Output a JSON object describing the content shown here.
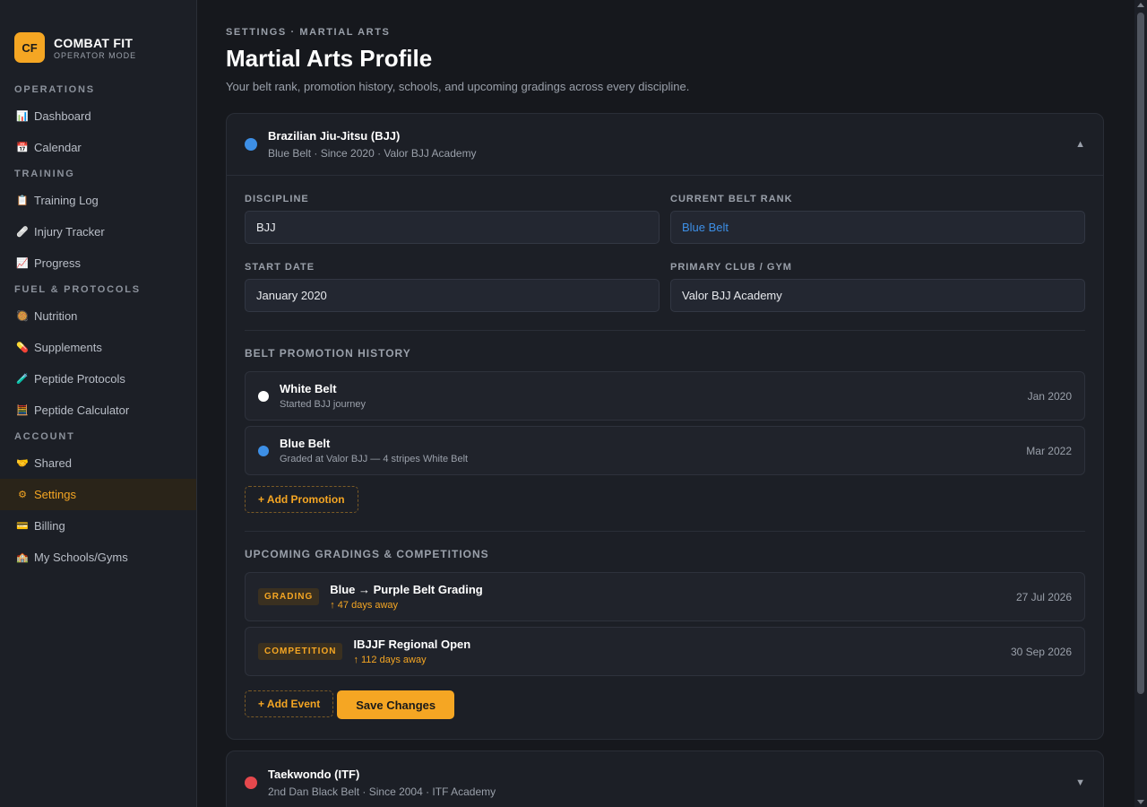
{
  "brand": {
    "logo": "CF",
    "name": "COMBAT FIT",
    "sub": "OPERATOR MODE"
  },
  "nav": {
    "sections": [
      {
        "label": "OPERATIONS",
        "items": [
          {
            "label": "Dashboard",
            "icon": "📊"
          },
          {
            "label": "Calendar",
            "icon": "📅"
          }
        ]
      },
      {
        "label": "TRAINING",
        "items": [
          {
            "label": "Training Log",
            "icon": "📋"
          },
          {
            "label": "Injury Tracker",
            "icon": "🩹"
          },
          {
            "label": "Progress",
            "icon": "📈"
          }
        ]
      },
      {
        "label": "FUEL & PROTOCOLS",
        "items": [
          {
            "label": "Nutrition",
            "icon": "🥘"
          },
          {
            "label": "Supplements",
            "icon": "💊"
          },
          {
            "label": "Peptide Protocols",
            "icon": "🧪"
          },
          {
            "label": "Peptide Calculator",
            "icon": "🧮"
          }
        ]
      },
      {
        "label": "ACCOUNT",
        "items": [
          {
            "label": "Shared",
            "icon": "🤝"
          },
          {
            "label": "Settings",
            "icon": "⚙"
          },
          {
            "label": "Billing",
            "icon": "💳"
          },
          {
            "label": "My Schools/Gyms",
            "icon": "🏫"
          }
        ]
      }
    ],
    "active": "Settings"
  },
  "header": {
    "breadcrumb": "SETTINGS · MARTIAL ARTS",
    "title": "Martial Arts Profile",
    "subtitle": "Your belt rank, promotion history, schools, and upcoming gradings across every discipline."
  },
  "bjj": {
    "title": "Brazilian Jiu-Jitsu (BJJ)",
    "sub": "Blue Belt · Since 2020 · Valor BJJ Academy",
    "color": "#3d8fe6",
    "caret": "▲",
    "fields": {
      "discipline_label": "DISCIPLINE",
      "discipline_value": "BJJ",
      "rank_label": "CURRENT BELT RANK",
      "rank_value": "Blue Belt",
      "start_label": "START DATE",
      "start_value": "January 2020",
      "club_label": "PRIMARY CLUB / GYM",
      "club_value": "Valor BJJ Academy"
    },
    "history_title": "BELT PROMOTION HISTORY",
    "history": [
      {
        "title": "White Belt",
        "sub": "Started BJJ journey",
        "date": "Jan 2020",
        "color": "#ffffff"
      },
      {
        "title": "Blue Belt",
        "sub": "Graded at Valor BJJ — 4 stripes White Belt",
        "date": "Mar 2022",
        "color": "#3d8fe6"
      }
    ],
    "add_promotion": "+ Add Promotion",
    "events_title": "UPCOMING GRADINGS & COMPETITIONS",
    "events": [
      {
        "badge": "GRADING",
        "title": "Blue → Purple Belt Grading",
        "sub": "↑ 47 days away",
        "date": "27 Jul 2026"
      },
      {
        "badge": "COMPETITION",
        "title": "IBJJF Regional Open",
        "sub": "↑ 112 days away",
        "date": "30 Sep 2026"
      }
    ],
    "add_event": "+ Add Event",
    "save": "Save Changes"
  },
  "tkd": {
    "title": "Taekwondo (ITF)",
    "sub": "2nd Dan Black Belt · Since 2004 · ITF Academy",
    "color": "#e5484d",
    "caret": "▼"
  }
}
